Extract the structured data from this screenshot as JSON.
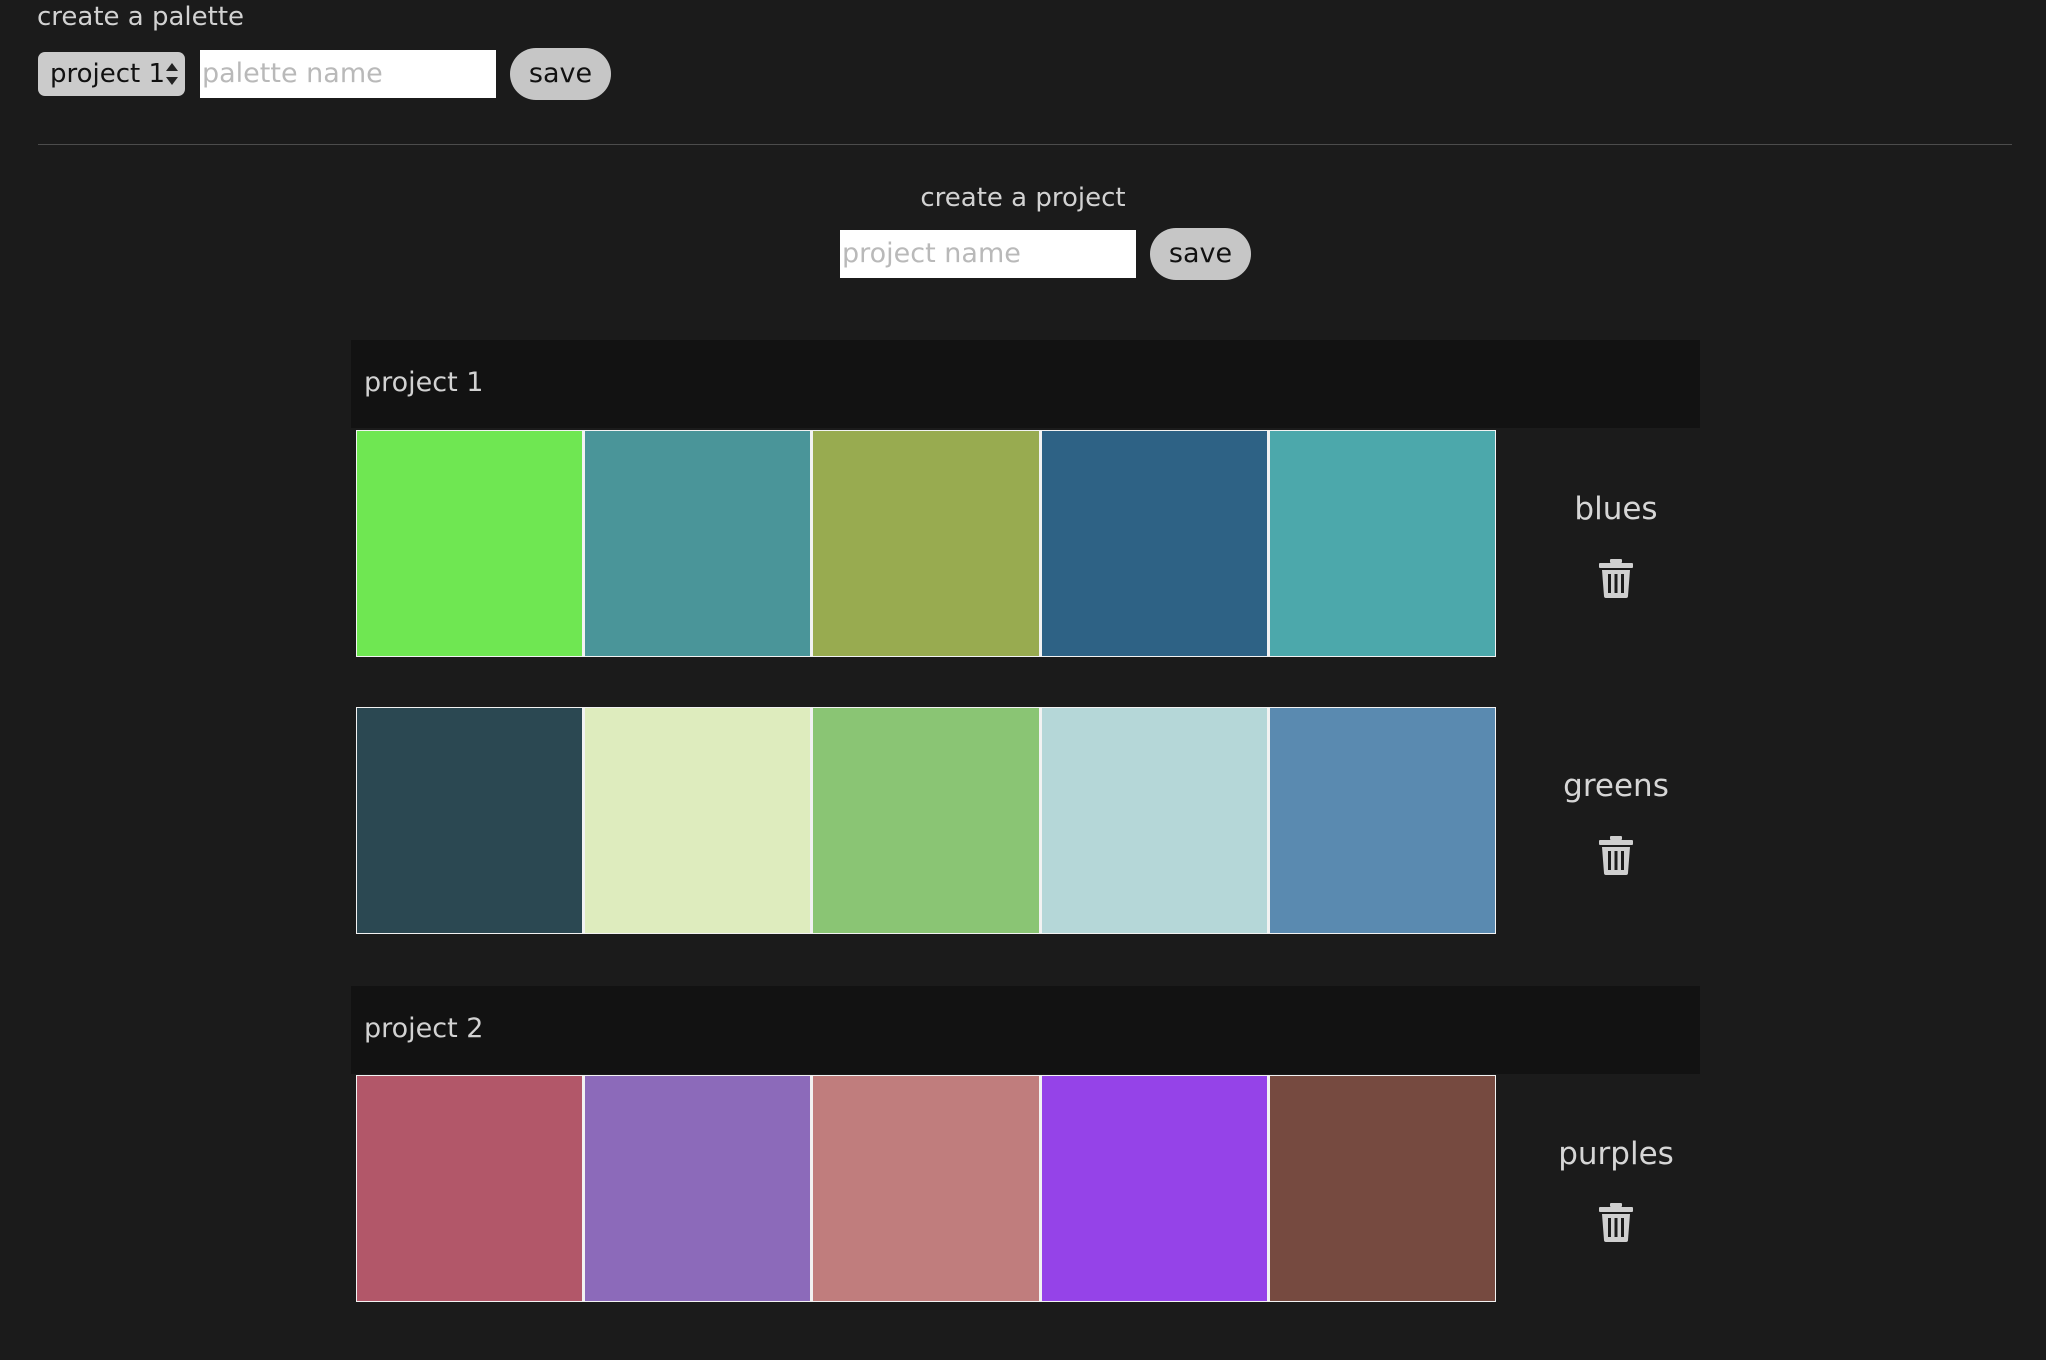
{
  "palette_form": {
    "title": "create a palette",
    "project_select_value": "project 1",
    "name_placeholder": "palette name",
    "save_label": "save"
  },
  "project_form": {
    "title": "create a project",
    "name_placeholder": "project name",
    "save_label": "save"
  },
  "projects": [
    {
      "name": "project 1",
      "palettes": [
        {
          "name": "blues",
          "delete_icon": "trash-icon",
          "colors": [
            "#6fe752",
            "#4a9599",
            "#98ab50",
            "#2e6285",
            "#4ca8ab"
          ]
        },
        {
          "name": "greens",
          "delete_icon": "trash-icon",
          "colors": [
            "#2b4852",
            "#deecbe",
            "#8ac574",
            "#b5d7d8",
            "#5a8ab0"
          ]
        }
      ]
    },
    {
      "name": "project 2",
      "palettes": [
        {
          "name": "purples",
          "delete_icon": "trash-icon",
          "colors": [
            "#b25769",
            "#8c6aba",
            "#c07d7d",
            "#9543e8",
            "#764a40"
          ]
        }
      ]
    }
  ]
}
